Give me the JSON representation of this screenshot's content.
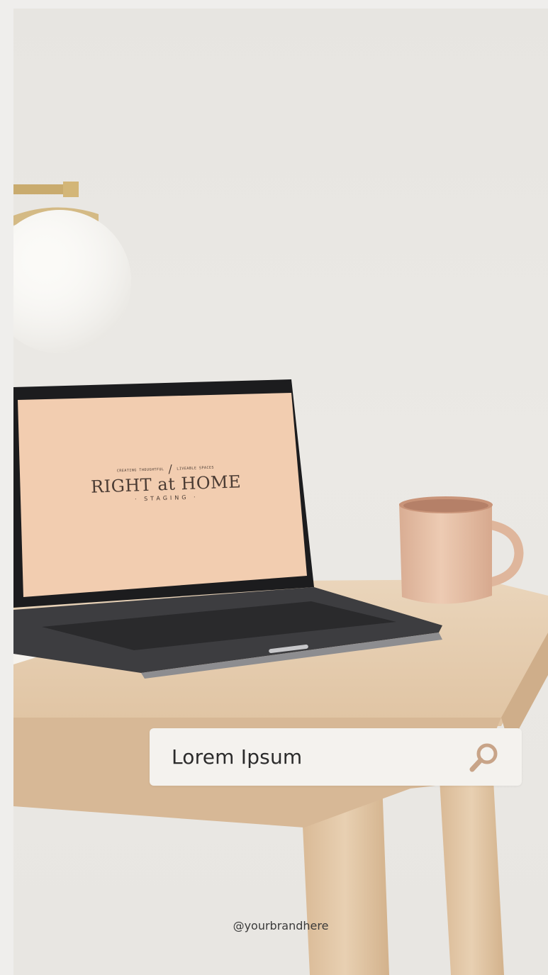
{
  "search": {
    "text": "Lorem Ipsum",
    "icon": "search-icon"
  },
  "footer": {
    "handle": "@yourbrandhere"
  },
  "laptop_screen": {
    "tag_left": "CREATING THOUGHTFUL",
    "tag_right": "LIVEABLE SPACES",
    "brand": "RIGHT at HOME",
    "sub": "· STAGING ·"
  },
  "colors": {
    "wall": "#e8e6e2",
    "desk": "#e2c9ad",
    "screen": "#f2cdb0",
    "mug": "#e9c3aa",
    "search_bg": "#f4f2ee"
  }
}
